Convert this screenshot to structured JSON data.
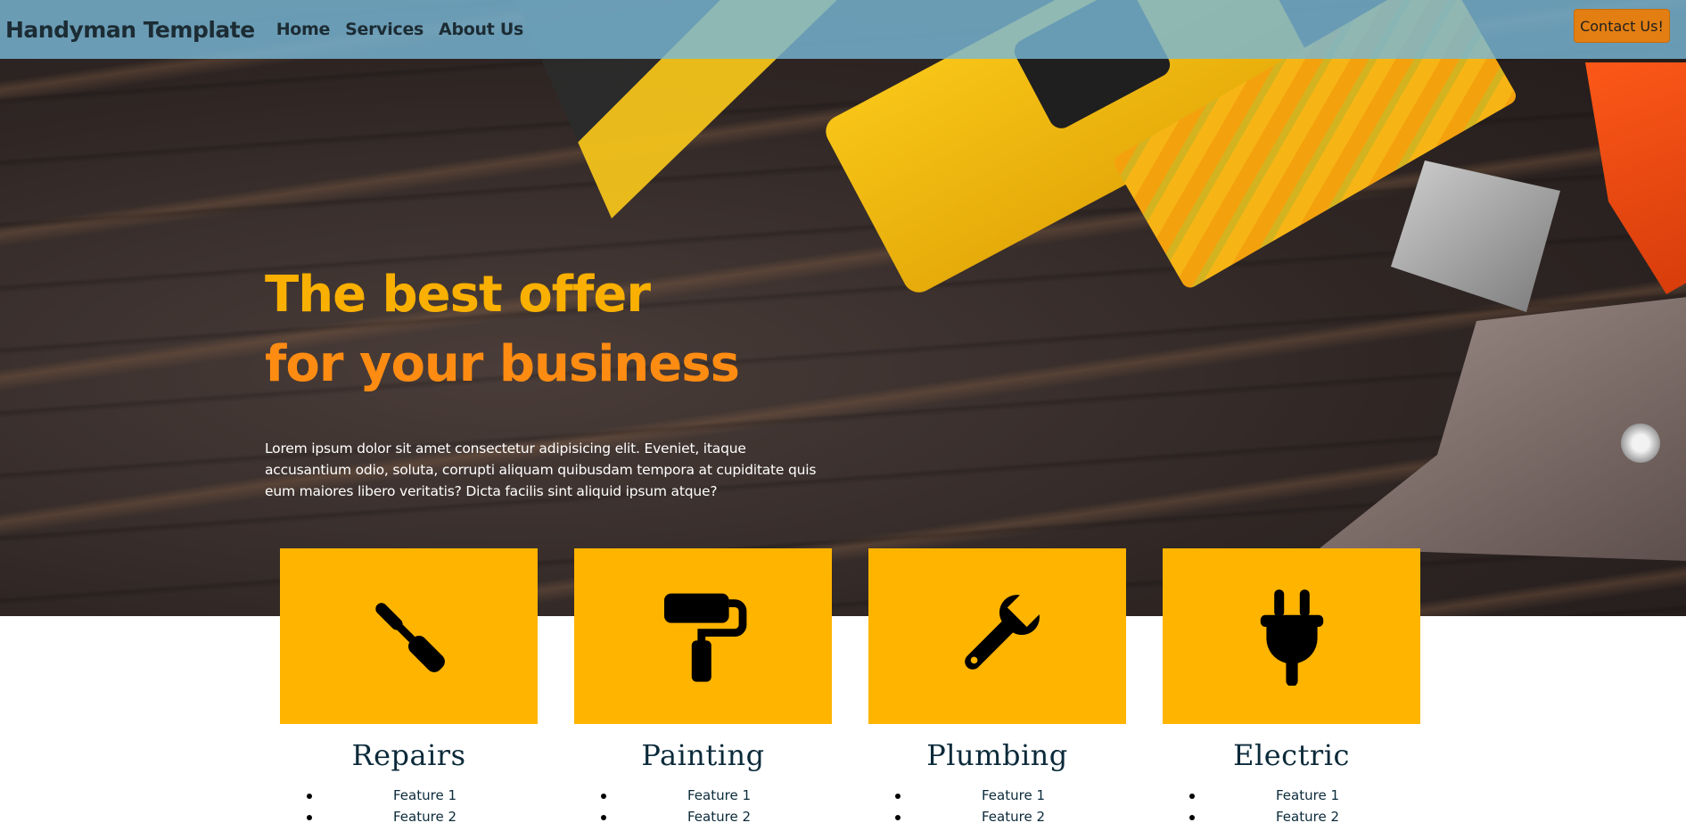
{
  "navbar": {
    "brand": "Handyman Template",
    "links": [
      "Home",
      "Services",
      "About Us"
    ],
    "contact_label": "Contact Us!"
  },
  "hero": {
    "title_line1": "The best offer",
    "title_line2": "for your business",
    "text": "Lorem ipsum dolor sit amet consectetur adipisicing elit. Eveniet, itaque accusantium odio, soluta, corrupti aliquam quibusdam tempora at cupiditate quis eum maiores libero veritatis? Dicta facilis sint aliquid ipsum atque?"
  },
  "services": [
    {
      "title": "Repairs",
      "icon": "screwdriver-icon",
      "features": [
        "Feature 1",
        "Feature 2"
      ]
    },
    {
      "title": "Painting",
      "icon": "paint-roller-icon",
      "features": [
        "Feature 1",
        "Feature 2"
      ]
    },
    {
      "title": "Plumbing",
      "icon": "wrench-icon",
      "features": [
        "Feature 1",
        "Feature 2"
      ]
    },
    {
      "title": "Electric",
      "icon": "plug-icon",
      "features": [
        "Feature 1",
        "Feature 2"
      ]
    }
  ],
  "colors": {
    "navbar_bg": "#79b7d6",
    "accent": "#ffb400",
    "title_yellow": "#f9b000",
    "title_orange": "#ff8c12",
    "contact_button": "#e37f12",
    "text_dark": "#0b2a3a"
  }
}
